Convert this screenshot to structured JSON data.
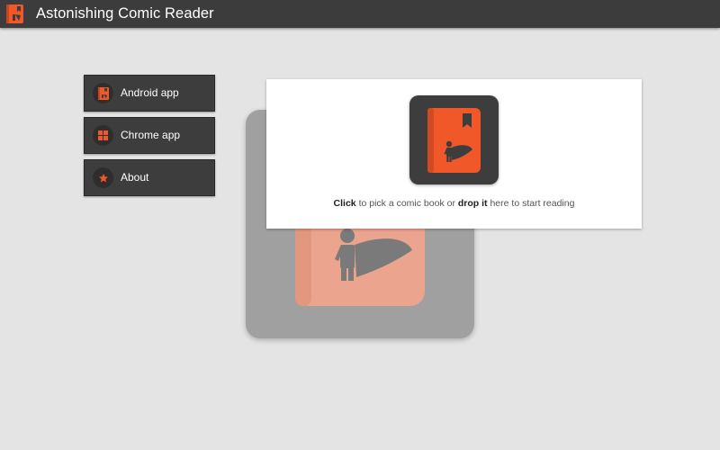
{
  "window": {
    "title": "Astonishing Comic Reader",
    "icon": "comic-book-icon"
  },
  "colors": {
    "accent": "#f0582a",
    "titlebar": "#3c3c3c",
    "background": "#e4e4e4",
    "menu_bg": "#3d3d3d"
  },
  "menu": {
    "items": [
      {
        "label": "Android app",
        "icon": "android-app-icon"
      },
      {
        "label": "Chrome app",
        "icon": "grid-icon"
      },
      {
        "label": "About",
        "icon": "star-icon"
      }
    ]
  },
  "drop_zone": {
    "click_word": "Click",
    "text_middle": "to pick a comic book or",
    "drop_word": "drop it",
    "text_end": "here to start reading",
    "icon": "comic-book-icon"
  }
}
